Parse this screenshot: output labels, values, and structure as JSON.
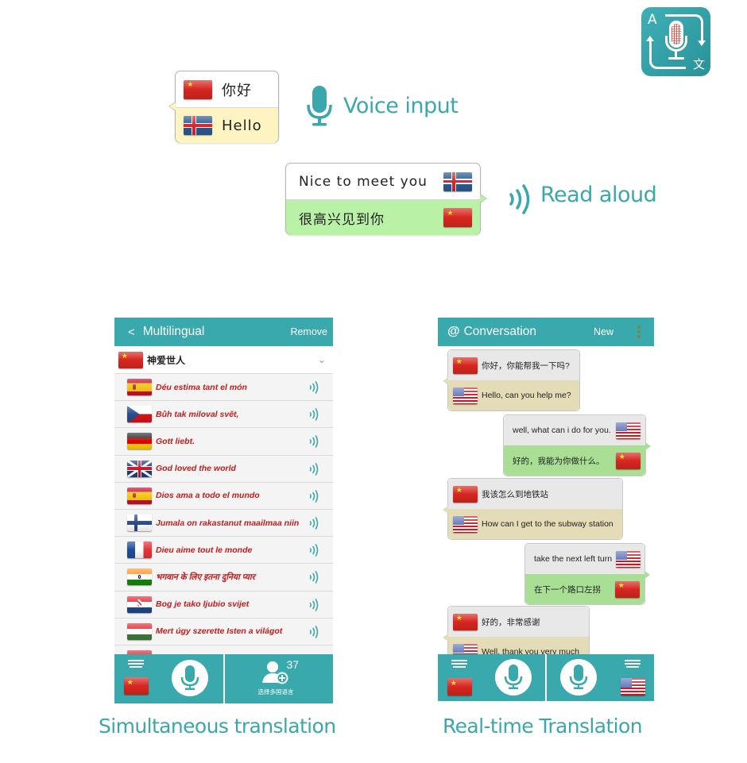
{
  "app_icon": {
    "letter_a": "A",
    "letter_wen": "文",
    "icon": "app-logo-mic-translate-icon"
  },
  "voice_input": {
    "label": "Voice input",
    "icon": "microphone-icon",
    "bubble": {
      "top": {
        "flag": "cn",
        "text": "你好"
      },
      "bottom": {
        "flag": "is",
        "text": "Hello"
      }
    }
  },
  "read_aloud": {
    "label": "Read aloud",
    "icon": "speaker-waves-icon",
    "bubble": {
      "top": {
        "flag": "is",
        "text": "Nice to meet you"
      },
      "bottom": {
        "flag": "cn",
        "text": "很高兴见到你"
      }
    }
  },
  "multilingual": {
    "header": {
      "back": "<",
      "title": "Multilingual",
      "action": "Remove"
    },
    "source": {
      "flag": "cn",
      "text": "神爱世人",
      "chevron": "⌄"
    },
    "translations": [
      {
        "flag": "es",
        "text": "Déu estima tant el món"
      },
      {
        "flag": "cz",
        "text": "Bůh tak miloval svět,"
      },
      {
        "flag": "de",
        "text": "Gott liebt."
      },
      {
        "flag": "uk",
        "text": "God loved the world"
      },
      {
        "flag": "es",
        "text": "Dios ama a todo el mundo"
      },
      {
        "flag": "fi",
        "text": "Jumala on rakastanut maailmaa niin"
      },
      {
        "flag": "fr",
        "text": "Dieu aime tout le monde"
      },
      {
        "flag": "in",
        "text": "भगवान के लिए इतना दुनिया प्यार"
      },
      {
        "flag": "hr",
        "text": "Bog je tako ljubio svijet"
      },
      {
        "flag": "hu",
        "text": "Mert úgy szerette Isten a világot"
      }
    ],
    "bottom": {
      "flag": "cn",
      "add_count": "37",
      "add_label": "选择多国语言"
    },
    "caption": "Simultaneous translation"
  },
  "conversation": {
    "header": {
      "logo": "@",
      "title": "Conversation",
      "action": "New"
    },
    "messages": [
      {
        "side": "left",
        "top": {
          "flag": "cn",
          "text": "你好，你能帮我一下吗?"
        },
        "bottom": {
          "flag": "us",
          "text": "Hello, can you help me?"
        }
      },
      {
        "side": "right",
        "top": {
          "flag": "us",
          "text": "well, what can i do for you."
        },
        "bottom": {
          "flag": "cn",
          "text": "好的，我能为你做什么。"
        }
      },
      {
        "side": "left",
        "top": {
          "flag": "cn",
          "text": "我该怎么到地铁站"
        },
        "bottom": {
          "flag": "us",
          "text": "How can I get to the subway station"
        }
      },
      {
        "side": "right",
        "top": {
          "flag": "us",
          "text": "take the next left turn"
        },
        "bottom": {
          "flag": "cn",
          "text": "在下一个路口左拐"
        }
      },
      {
        "side": "left",
        "top": {
          "flag": "cn",
          "text": "好的，非常感谢"
        },
        "bottom": {
          "flag": "us",
          "text": "Well, thank you very much"
        }
      }
    ],
    "bottom": {
      "left_flag": "cn",
      "right_flag": "us"
    },
    "caption": "Real-time Translation"
  },
  "colors": {
    "accent": "#39a9ad",
    "label_teal": "#3aa7ad",
    "translation_red": "#c81a1a",
    "bubble_yellow": "#fdf4c2",
    "bubble_green": "#b9f1a6",
    "conv_green": "#a8df95",
    "conv_tan": "#e3dcb6"
  }
}
